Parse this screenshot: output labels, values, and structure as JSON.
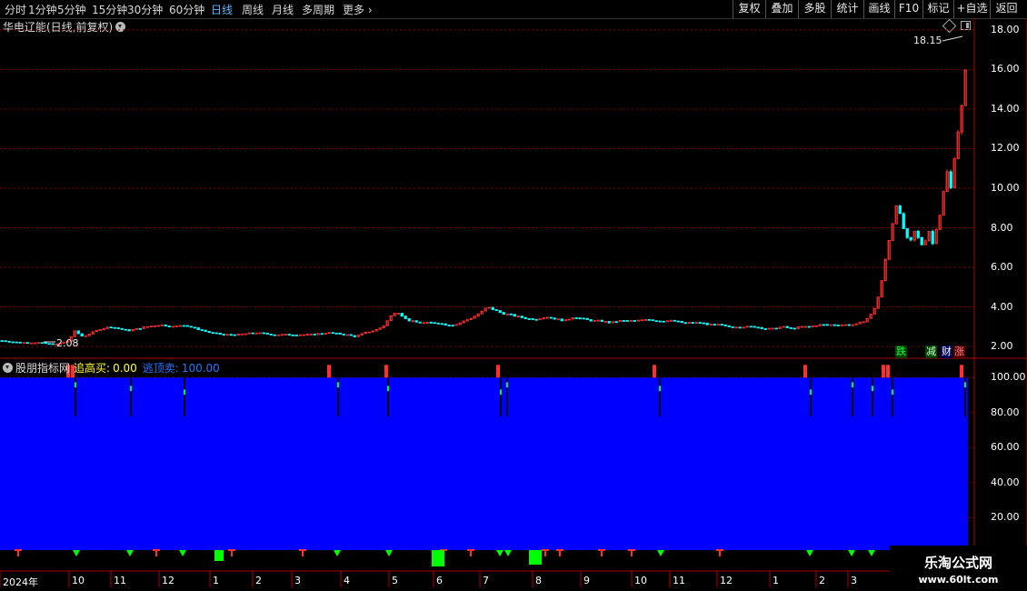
{
  "toolbar": {
    "periods": [
      "分时",
      "1分钟",
      "5分钟",
      "15分钟",
      "30分钟",
      "60分钟",
      "日线",
      "周线",
      "月线",
      "多周期",
      "更多"
    ],
    "active_period": "日线",
    "buttons": [
      "复权",
      "叠加",
      "多股",
      "统计",
      "画线",
      "F10",
      "标记",
      "+自选",
      "返回"
    ]
  },
  "main_chart": {
    "title": "华电辽能(日线,前复权)",
    "high_label": "18.15",
    "low_label": "2.08",
    "flags": [
      "跌",
      "减",
      "财",
      "涨"
    ]
  },
  "indicator": {
    "name": "股朋指标网",
    "chase_label": "追高买:",
    "chase_value": "0.00",
    "escape_label": "逃顶卖:",
    "escape_value": "100.00"
  },
  "watermark": {
    "name": "乐淘公式网",
    "url": "www.60lt.com"
  },
  "colors": {
    "up": "#ff3030",
    "down": "#00ffff",
    "fill": "#0000ff",
    "green": "#00ff00",
    "grid": "#8b0000"
  },
  "chart_data": [
    {
      "type": "candlestick",
      "y_ticks": [
        "2.00",
        "4.00",
        "6.00",
        "8.00",
        "10.00",
        "12.00",
        "14.00",
        "16.00",
        "18.00"
      ],
      "ylim": [
        1.5,
        18.5
      ],
      "x_ticks": [
        "2024年",
        "10",
        "11",
        "12",
        "1",
        "2",
        "3",
        "4",
        "5",
        "6",
        "7",
        "8",
        "9",
        "10",
        "11",
        "12",
        "1",
        "2",
        "3"
      ],
      "x": [
        0,
        20,
        40,
        60,
        75,
        80,
        90,
        100,
        110,
        120,
        130,
        140,
        150,
        160,
        175,
        190,
        200,
        215,
        230,
        245,
        260,
        280,
        300,
        320,
        340,
        360,
        380,
        390,
        400,
        410,
        420,
        425,
        430,
        435,
        440,
        445,
        450,
        460,
        470,
        480,
        490,
        500,
        510,
        520,
        530,
        535,
        540,
        545,
        550,
        560,
        570,
        580,
        590,
        600,
        610,
        620,
        630,
        640,
        650,
        660,
        670,
        680,
        690,
        700,
        710,
        720,
        730,
        740,
        750,
        760,
        770,
        780,
        790,
        800,
        810,
        820,
        830,
        840,
        850,
        860,
        870,
        880,
        890,
        900,
        910,
        920,
        930,
        940,
        950,
        955,
        960,
        965,
        970,
        975,
        980,
        985,
        990,
        995,
        1000,
        1005,
        1010,
        1015,
        1020,
        1025,
        1030,
        1035,
        1040,
        1045,
        1050,
        1055,
        1060,
        1063
      ],
      "values": [
        2.3,
        2.2,
        2.2,
        2.1,
        2.3,
        2.8,
        2.5,
        2.7,
        2.9,
        3.0,
        2.9,
        2.8,
        2.9,
        3.0,
        3.1,
        3.0,
        3.1,
        2.9,
        2.7,
        2.6,
        2.6,
        2.7,
        2.6,
        2.6,
        2.6,
        2.7,
        2.6,
        2.5,
        2.7,
        2.8,
        3.0,
        3.3,
        3.6,
        3.8,
        3.6,
        3.4,
        3.3,
        3.2,
        3.2,
        3.2,
        3.1,
        3.1,
        3.3,
        3.5,
        3.8,
        4.0,
        3.9,
        3.8,
        3.7,
        3.6,
        3.5,
        3.4,
        3.4,
        3.5,
        3.4,
        3.3,
        3.5,
        3.4,
        3.3,
        3.3,
        3.2,
        3.3,
        3.3,
        3.3,
        3.4,
        3.3,
        3.3,
        3.3,
        3.2,
        3.2,
        3.2,
        3.1,
        3.1,
        3.0,
        3.0,
        3.0,
        3.0,
        2.9,
        2.9,
        3.0,
        2.9,
        3.0,
        3.0,
        3.1,
        3.1,
        3.1,
        3.1,
        3.1,
        3.3,
        3.5,
        3.8,
        4.5,
        5.5,
        7.0,
        8.0,
        9.2,
        8.5,
        7.6,
        7.2,
        7.8,
        7.4,
        7.0,
        8.0,
        7.2,
        8.2,
        9.0,
        11.0,
        10.0,
        12.0,
        13.5,
        15.0,
        17.5
      ]
    },
    {
      "type": "area",
      "y_ticks": [
        "20.00",
        "40.00",
        "60.00",
        "80.00",
        "100.00"
      ],
      "ylim": [
        0,
        110
      ],
      "series": [
        {
          "name": "逃顶卖",
          "values": [
            100
          ]
        },
        {
          "name": "追高买",
          "values": [
            0
          ]
        }
      ]
    }
  ]
}
